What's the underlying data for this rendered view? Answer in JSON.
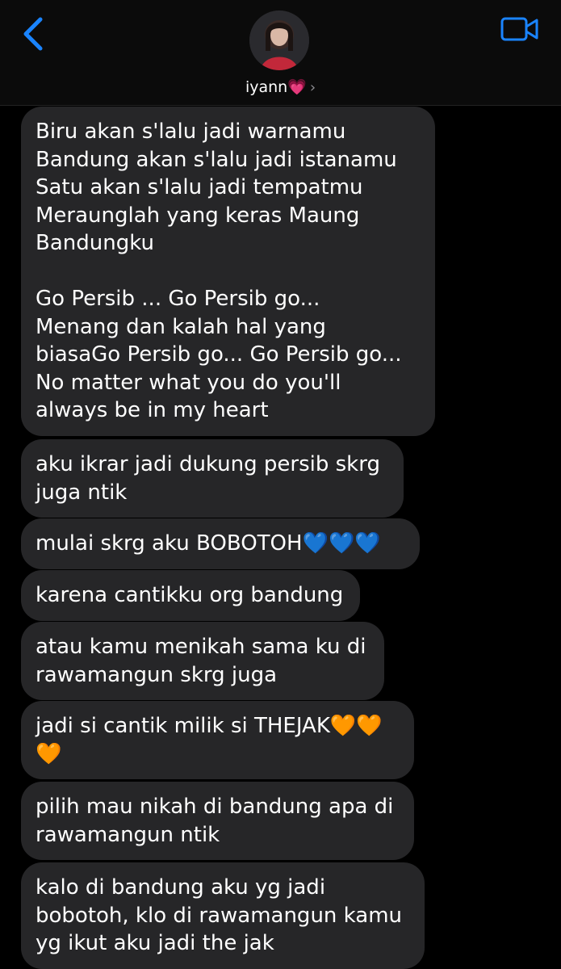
{
  "header": {
    "contact_name": "iyann💗",
    "chevron": "›",
    "back_icon": "chevron-left-icon",
    "video_icon": "video-camera-icon",
    "accent_color": "#1a84ff"
  },
  "messages": [
    {
      "text": "Biru akan s'lalu jadi warnamu\nBandung akan s'lalu jadi istanamu\nSatu akan s'lalu jadi tempatmu\nMeraunglah yang keras Maung\nBandungku\n\nGo Persib ... Go Persib go...\nMenang dan kalah hal yang\nbiasaGo Persib go... Go Persib go...\nNo matter what you do you'll\nalways be in my heart"
    },
    {
      "text": "aku ikrar jadi dukung persib skrg\njuga ntik"
    },
    {
      "text": "mulai skrg aku BOBOTOH💙💙💙"
    },
    {
      "text": "karena cantikku org bandung"
    },
    {
      "text": "atau kamu menikah sama ku di\nrawamangun skrg juga"
    },
    {
      "text": "jadi si cantik milik si THEJAK🧡🧡\n🧡"
    },
    {
      "text": "pilih mau nikah di bandung apa di\nrawamangun ntik"
    },
    {
      "text": "kalo di bandung aku yg jadi\nbobotoh, klo di rawamangun kamu\nyg ikut aku jadi the jak"
    }
  ]
}
